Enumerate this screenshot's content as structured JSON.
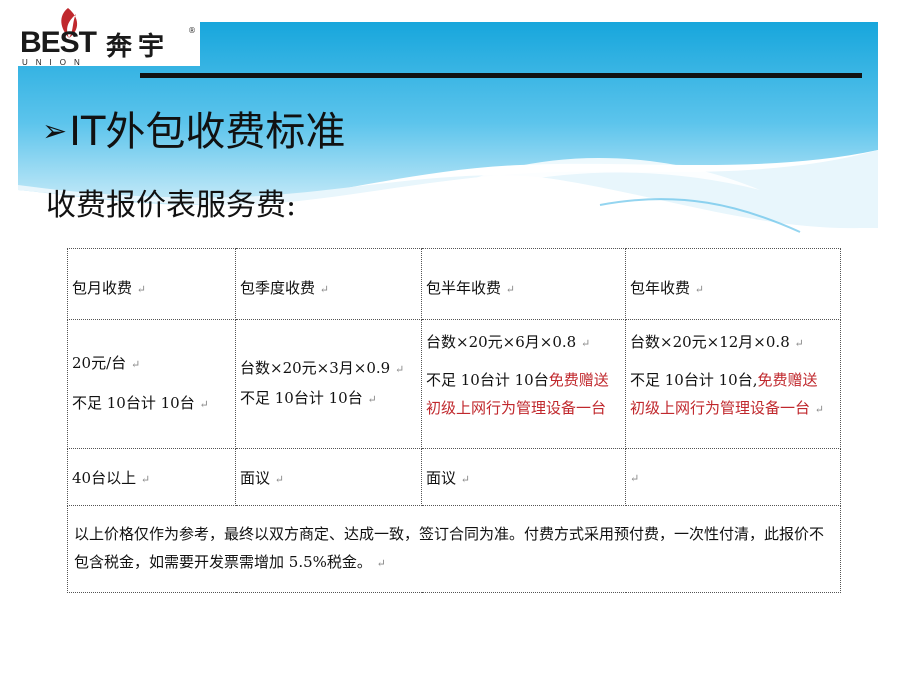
{
  "logo": {
    "brand_en": "BEST",
    "brand_sub": "UNION",
    "brand_cn": "奔宇",
    "reg": "®"
  },
  "colors": {
    "banner_top": "#1fa9dc",
    "banner_bottom": "#bfe6f6",
    "rule": "#111111",
    "promo_text": "#c0282d"
  },
  "slide": {
    "title_arrow": "➢",
    "title": "IT外包收费标准",
    "subtitle": "收费报价表服务费:"
  },
  "table": {
    "headers": [
      "包月收费",
      "包季度收费",
      "包半年收费",
      "包年收费"
    ],
    "price_row": {
      "monthly": {
        "line1": "20元/台",
        "line2": "不足 10台计 10台"
      },
      "quarterly": {
        "line1": "台数×20元×3月×0.9",
        "line2": "不足 10台计 10台"
      },
      "half_year": {
        "line1": "台数×20元×6月×0.8",
        "line2a": "不足 10台计 10台",
        "promo_a": "免费赠送",
        "promo_b": "初级上网行为管理设备一台"
      },
      "yearly": {
        "line1": "台数×20元×12月×0.8",
        "line2a": "不足 10台计 10台,",
        "promo_a": "免费赠送",
        "promo_b": "初级上网行为管理设备一台"
      }
    },
    "bulk_row": [
      "40台以上",
      "面议",
      "面议",
      ""
    ],
    "note": "以上价格仅作为参考，最终以双方商定、达成一致，签订合同为准。付费方式采用预付费，一次性付清，此报价不包含税金，如需要开发票需增加 5.5%税金。"
  }
}
